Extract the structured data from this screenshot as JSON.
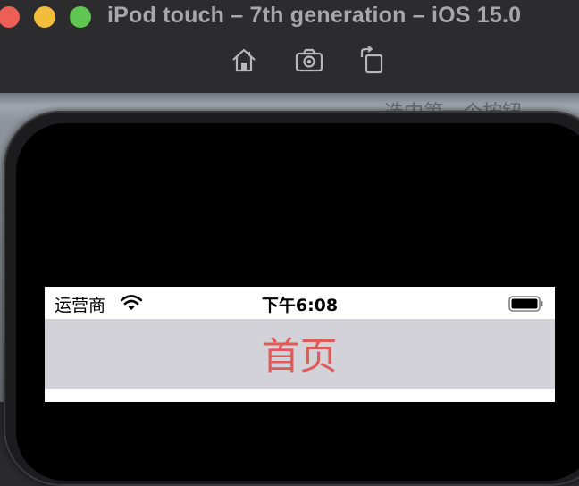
{
  "window": {
    "title": "iPod touch – 7th generation – iOS 15.0",
    "toolbar": {
      "home_icon": "home-icon",
      "screenshot_icon": "camera-icon",
      "rotate_icon": "rotate-icon"
    },
    "traffic_lights": {
      "close": "#ec5f57",
      "minimize": "#f2bd3a",
      "maximize": "#5fc652"
    }
  },
  "backdrop": {
    "partial_text": "选中第一个按钮"
  },
  "device": {
    "status_bar": {
      "carrier": "运营商",
      "time": "下午6:08",
      "wifi_icon": "wifi-icon",
      "battery_icon": "battery-icon"
    },
    "nav_bar": {
      "title": "首页",
      "title_color": "#e05a5a",
      "background": "#d3d2d8"
    }
  }
}
